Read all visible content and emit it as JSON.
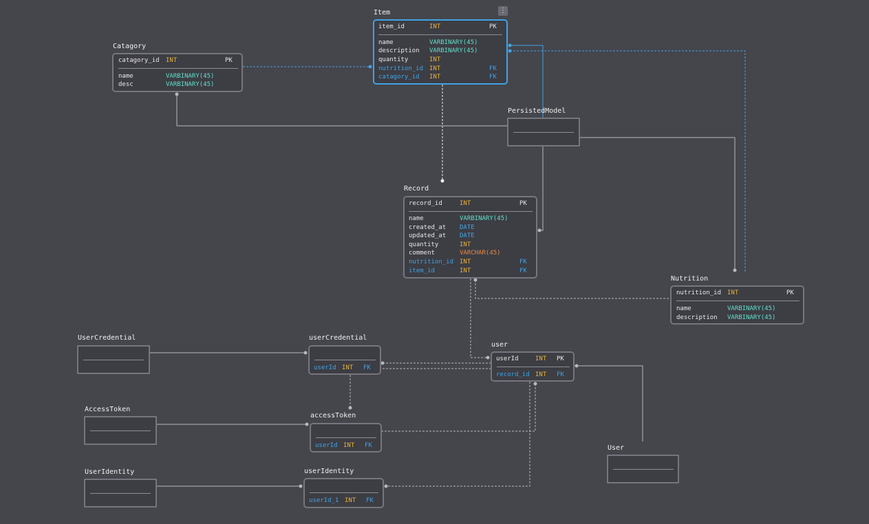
{
  "menu": {
    "icon": "⋮"
  },
  "tables": {
    "item": {
      "title": "Item",
      "rows": [
        {
          "name": "item_id",
          "type": "INT",
          "key": "PK"
        },
        {
          "name": "name",
          "type": "VARBINARY(45)",
          "key": ""
        },
        {
          "name": "description",
          "type": "VARBINARY(45)",
          "key": ""
        },
        {
          "name": "quantity",
          "type": "INT",
          "key": ""
        },
        {
          "name": "nutrition_id",
          "type": "INT",
          "key": "FK"
        },
        {
          "name": "catagory_id",
          "type": "INT",
          "key": "FK"
        }
      ]
    },
    "catagory": {
      "title": "Catagory",
      "rows": [
        {
          "name": "catagory_id",
          "type": "INT",
          "key": "PK"
        },
        {
          "name": "name",
          "type": "VARBINARY(45)",
          "key": ""
        },
        {
          "name": "desc",
          "type": "VARBINARY(45)",
          "key": ""
        }
      ]
    },
    "persisted_model": {
      "title": "PersistedModel"
    },
    "record": {
      "title": "Record",
      "rows": [
        {
          "name": "record_id",
          "type": "INT",
          "key": "PK"
        },
        {
          "name": "name",
          "type": "VARBINARY(45)",
          "key": ""
        },
        {
          "name": "created_at",
          "type": "DATE",
          "key": ""
        },
        {
          "name": "updated_at",
          "type": "DATE",
          "key": ""
        },
        {
          "name": "quantity",
          "type": "INT",
          "key": ""
        },
        {
          "name": "comment",
          "type": "VARCHAR(45)",
          "key": ""
        },
        {
          "name": "nutrition_id",
          "type": "INT",
          "key": "FK"
        },
        {
          "name": "item_id",
          "type": "INT",
          "key": "FK"
        }
      ]
    },
    "nutrition": {
      "title": "Nutrition",
      "rows": [
        {
          "name": "nutrition_id",
          "type": "INT",
          "key": "PK"
        },
        {
          "name": "name",
          "type": "VARBINARY(45)",
          "key": ""
        },
        {
          "name": "description",
          "type": "VARBINARY(45)",
          "key": ""
        }
      ]
    },
    "user_credential_model": {
      "title": "UserCredential"
    },
    "user_credential": {
      "title": "userCredential",
      "rows": [
        {
          "name": "userId",
          "type": "INT",
          "key": "FK"
        }
      ]
    },
    "user": {
      "title": "user",
      "rows": [
        {
          "name": "userId",
          "type": "INT",
          "key": "PK"
        },
        {
          "name": "record_id",
          "type": "INT",
          "key": "FK"
        }
      ]
    },
    "access_token_model": {
      "title": "AccessToken"
    },
    "access_token": {
      "title": "accessToken",
      "rows": [
        {
          "name": "userId",
          "type": "INT",
          "key": "FK"
        }
      ]
    },
    "user_identity_model": {
      "title": "UserIdentity"
    },
    "user_identity": {
      "title": "userIdentity",
      "rows": [
        {
          "name": "userId_1",
          "type": "INT",
          "key": "FK"
        }
      ]
    },
    "user_model": {
      "title": "User"
    }
  }
}
